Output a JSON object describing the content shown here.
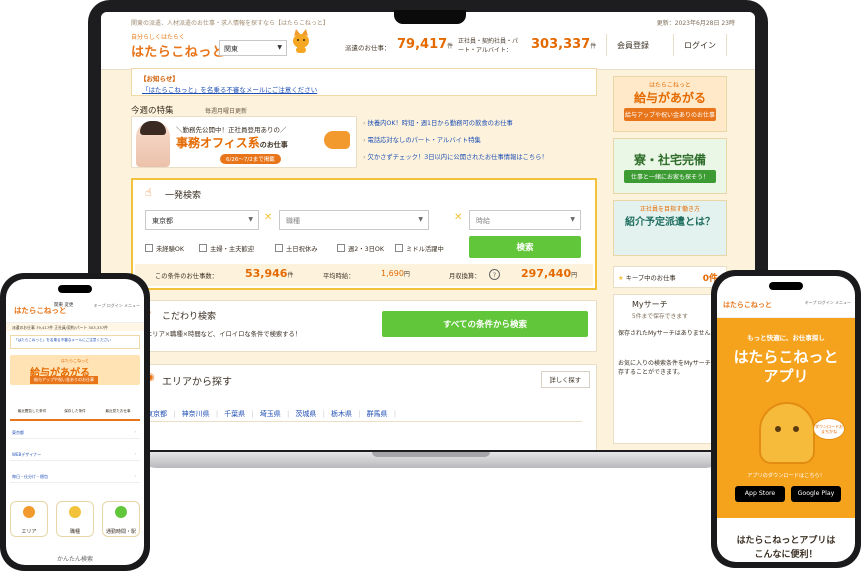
{
  "desktop": {
    "tagline": "関東の派遣、人材派遣のお仕事・求人情報を探すなら【はたらこねっと】",
    "updated": "更新：2023年6月28日 23時",
    "logo_small": "自分らしくはたらく",
    "logo": "はたらこねっと",
    "region": "関東",
    "stats": {
      "dispatch_label": "派遣のお仕事：",
      "dispatch_value": "79,417",
      "unit": "件",
      "other_label": "正社員・契約社員・パート・アルバイト：",
      "other_value": "303,337"
    },
    "header_buttons": {
      "register": "会員登録",
      "login": "ログイン"
    },
    "notice": {
      "label": "【お知らせ】",
      "link": "「はたらこねっと」を名乗る不審なメールにご注意ください"
    },
    "weekly": {
      "title": "今週の特集",
      "subtitle": "毎週月曜日更新",
      "banner_line1": "＼勤務先公開中！正社員登用ありの／",
      "banner_line2": "事務オフィス系",
      "banner_line2_suffix": "のお仕事",
      "banner_pill": "6/26〜7/2まで掲載",
      "links": [
        "扶養内OK！時短・週1日から勤務可の飲食のお仕事",
        "電話応対なしのパート・アルバイト特集",
        "欠かさずチェック！3日以内に公開されたお仕事情報はこちら！"
      ]
    },
    "search": {
      "title": "一発検索",
      "area": "東京都",
      "job_placeholder": "職種",
      "pay_placeholder": "時給",
      "checks": [
        "未経験OK",
        "主婦・主夫歓迎",
        "土日祝休み",
        "週2・3日OK",
        "ミドル活躍中"
      ],
      "button": "検索",
      "count_label": "この条件のお仕事数：",
      "count_value": "53,946",
      "unit": "件",
      "hourly_label": "平均時給：",
      "hourly_value": "1,690",
      "hourly_unit": "円",
      "monthly_label": "月収換算：",
      "monthly_value": "297,440",
      "monthly_unit": "円"
    },
    "kodawari": {
      "title": "こだわり検索",
      "desc": "エリア×職種×時間など、イロイロな条件で検索する！",
      "button": "すべての条件から検索"
    },
    "area": {
      "title": "エリアから探す",
      "more": "詳しく探す",
      "prefs": [
        "東京都",
        "神奈川県",
        "千葉県",
        "埼玉県",
        "茨城県",
        "栃木県",
        "群馬県"
      ]
    },
    "sidebar": {
      "ad1": {
        "top": "はたらこねっと",
        "main": "給与があがる",
        "sub": "給与アップや祝い金ありのお仕事"
      },
      "ad2": {
        "top": "",
        "main": "寮・社宅完備",
        "sub": "仕事と一緒にお家も探そう！"
      },
      "ad3": {
        "top": "正社員を目指す働き方",
        "main": "紹介予定派遣とは？",
        "sub": ""
      },
      "keep_label": "キープ中のお仕事",
      "keep_count": "0件",
      "mysearch_title": "Myサーチ",
      "mysearch_sub": "5件まで保存できます",
      "mysearch_t1": "保存されたMyサーチはありません。",
      "mysearch_t2": "お気に入りの検索条件をMyサーチに保存することができます。"
    }
  },
  "phone_left": {
    "logo": "はたらこねっと",
    "region": "関東 変更",
    "icons": "キープ ログイン メニュー",
    "stats": "派遣のお仕事 79,417件 正社員/契約/パート 303,337件",
    "notice": "「はたらこねっと」を名乗る不審なメールにご注意ください",
    "banner_top": "はたらこねっと",
    "banner_main": "給与があがる",
    "banner_sub": "給与アップや祝い金ありのお仕事",
    "tabs": [
      "最近閲覧した条件",
      "保存した条件",
      "最近見たお仕事"
    ],
    "list": [
      "東京都",
      "WEBデザイナー",
      "毎日・仕分け・梱包"
    ],
    "buttons": [
      "エリア",
      "職種",
      "通勤時間・駅"
    ],
    "easy": "かんたん検索"
  },
  "phone_right": {
    "logo": "はたらこねっと",
    "icons": "キープ ログイン メニュー",
    "line1": "もっと快適に、お仕事探し",
    "line2": "はたらこねっと",
    "line3": "アプリ",
    "bubble": "ダウンロードおまちかね",
    "download": "アプリのダウンロードはこちら！",
    "app_store": "App Store",
    "google_play": "Google Play",
    "bottom1": "はたらこねっとアプリは",
    "bottom2": "こんなに便利！"
  },
  "colors": {
    "accent": "#e8751a",
    "green": "#62c63a",
    "link": "#1f4fb5",
    "yellow": "#f2c23a"
  }
}
